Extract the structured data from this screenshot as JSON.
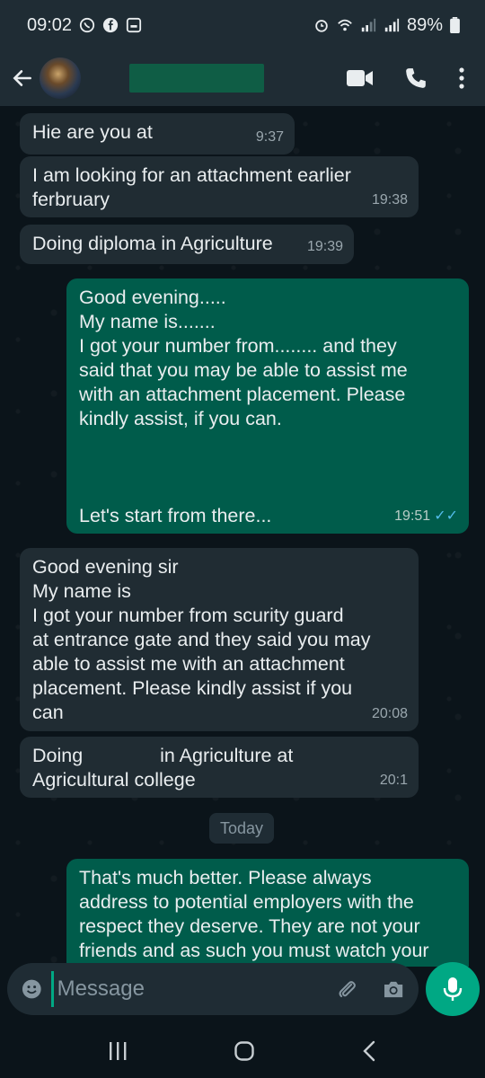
{
  "status_bar": {
    "time": "09:02",
    "battery": "89%",
    "left_icons": [
      "whatsapp-icon",
      "facebook-icon",
      "gallery-icon"
    ],
    "right_icons": [
      "alarm-icon",
      "wifi-icon",
      "signal-icon",
      "signal-icon",
      "battery-icon"
    ]
  },
  "header": {
    "back_icon": "back-arrow-icon",
    "actions": [
      "video-call-icon",
      "voice-call-icon",
      "more-options-icon"
    ]
  },
  "messages": [
    {
      "direction": "in",
      "lines": [
        "Hie are you at "
      ],
      "time": "9:37"
    },
    {
      "direction": "in",
      "lines": [
        "I am looking for an attachment earlier",
        "ferbruary"
      ],
      "time": "19:38"
    },
    {
      "direction": "in",
      "lines": [
        "Doing diploma in Agriculture"
      ],
      "time": "19:39"
    },
    {
      "direction": "out",
      "lines": [
        "Good evening.....",
        "My name is.......",
        "I got your number from........ and they",
        "said that you may be able to assist me",
        "with an attachment placement. Please",
        "kindly assist, if you can.",
        "",
        "",
        "",
        "Let's start from there..."
      ],
      "time": "19:51",
      "status": "read"
    },
    {
      "direction": "in",
      "lines": [
        "Good evening sir",
        "My name is",
        "I got your number from scurity guard",
        "at entrance gate and they said you may",
        "able to assist me with an attachment",
        "placement. Please kindly assist if you",
        "can"
      ],
      "time": "20:08"
    },
    {
      "direction": "in",
      "lines": [
        "Doing ",
        "in Agriculture at ",
        "Agricultural college"
      ],
      "time": "20:1"
    },
    {
      "direction": "out",
      "lines": [
        "That's much better. Please always",
        "address to potential employers with the",
        "respect they deserve. They are not your",
        "friends and as such you must watch your"
      ]
    }
  ],
  "day_divider": "Today",
  "input": {
    "placeholder": "Message"
  },
  "input_icons": [
    "emoji-icon",
    "attach-icon",
    "camera-icon",
    "mic-icon"
  ],
  "colors": {
    "incoming": "#202c33",
    "outgoing": "#005c4b",
    "accent": "#00a884",
    "background": "#0b141a"
  }
}
